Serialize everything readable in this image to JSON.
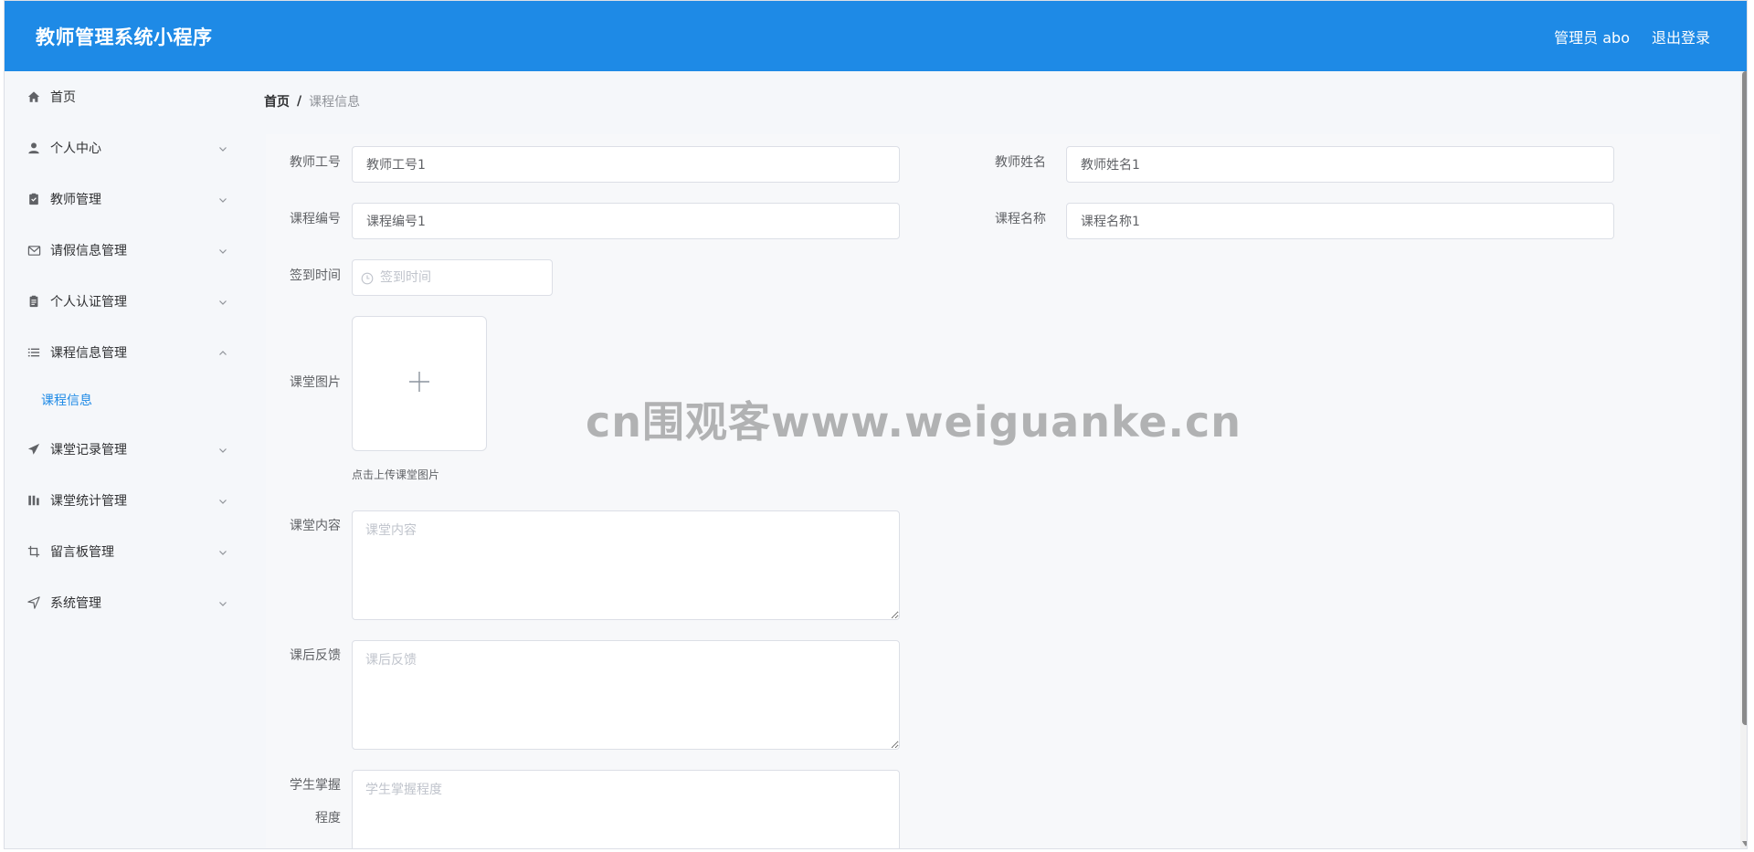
{
  "header": {
    "app_title": "教师管理系统小程序",
    "user_label": "管理员 abo",
    "logout_label": "退出登录"
  },
  "sidebar": {
    "items": [
      {
        "label": "首页",
        "icon": "home-icon",
        "expandable": false
      },
      {
        "label": "个人中心",
        "icon": "user-icon",
        "expandable": true
      },
      {
        "label": "教师管理",
        "icon": "clipboard-icon",
        "expandable": true
      },
      {
        "label": "请假信息管理",
        "icon": "mail-icon",
        "expandable": true
      },
      {
        "label": "个人认证管理",
        "icon": "document-icon",
        "expandable": true
      },
      {
        "label": "课程信息管理",
        "icon": "list-icon",
        "expandable": true,
        "expanded": true
      },
      {
        "label": "课堂记录管理",
        "icon": "send-icon",
        "expandable": true
      },
      {
        "label": "课堂统计管理",
        "icon": "chart-icon",
        "expandable": true
      },
      {
        "label": "留言板管理",
        "icon": "crop-icon",
        "expandable": true
      },
      {
        "label": "系统管理",
        "icon": "navigation-icon",
        "expandable": true
      }
    ],
    "subitem_active": "课程信息"
  },
  "breadcrumb": {
    "home": "首页",
    "separator": "/",
    "current": "课程信息"
  },
  "form": {
    "teacher_id": {
      "label": "教师工号",
      "value": "教师工号1"
    },
    "teacher_name": {
      "label": "教师姓名",
      "value": "教师姓名1"
    },
    "course_no": {
      "label": "课程编号",
      "value": "课程编号1"
    },
    "course_name": {
      "label": "课程名称",
      "value": "课程名称1"
    },
    "checkin_time": {
      "label": "签到时间",
      "placeholder": "签到时间"
    },
    "class_image": {
      "label": "课堂图片",
      "tip": "点击上传课堂图片"
    },
    "class_content": {
      "label": "课堂内容",
      "placeholder": "课堂内容"
    },
    "feedback": {
      "label": "课后反馈",
      "placeholder": "课后反馈"
    },
    "mastery": {
      "label_line1": "学生掌握",
      "label_line2": "程度",
      "placeholder": "学生掌握程度"
    }
  },
  "watermark": "cn围观客www.weiguanke.cn",
  "colors": {
    "header_bg": "#1e8ae6",
    "accent": "#1e8ae6",
    "page_bg": "#f5f7fa"
  }
}
